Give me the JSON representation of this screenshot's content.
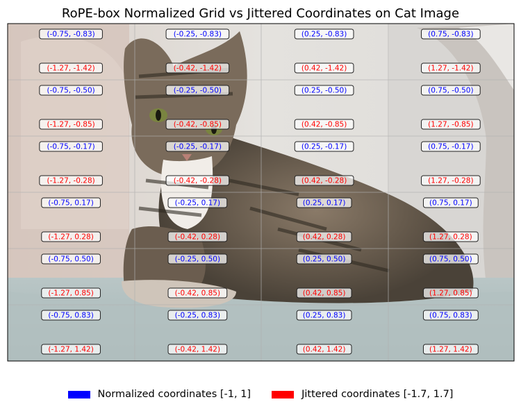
{
  "chart_data": {
    "type": "scatter",
    "title": "RoPE-box Normalized Grid vs Jittered Coordinates on Cat Image",
    "background_image": "cat-photo",
    "grid": true,
    "grid_columns": 4,
    "grid_rows": 6,
    "legend_placement": "bottom-center",
    "series": [
      {
        "name": "Normalized coordinates [-1, 1]",
        "color": "#0000ff",
        "labels": [
          [
            "(-0.75, -0.83)",
            "(-0.25, -0.83)",
            "(0.25, -0.83)",
            "(0.75, -0.83)"
          ],
          [
            "(-0.75, -0.50)",
            "(-0.25, -0.50)",
            "(0.25, -0.50)",
            "(0.75, -0.50)"
          ],
          [
            "(-0.75, -0.17)",
            "(-0.25, -0.17)",
            "(0.25, -0.17)",
            "(0.75, -0.17)"
          ],
          [
            "(-0.75, 0.17)",
            "(-0.25, 0.17)",
            "(0.25, 0.17)",
            "(0.75, 0.17)"
          ],
          [
            "(-0.75, 0.50)",
            "(-0.25, 0.50)",
            "(0.25, 0.50)",
            "(0.75, 0.50)"
          ],
          [
            "(-0.75, 0.83)",
            "(-0.25, 0.83)",
            "(0.25, 0.83)",
            "(0.75, 0.83)"
          ]
        ]
      },
      {
        "name": "Jittered coordinates [-1.7, 1.7]",
        "color": "#ff0000",
        "labels": [
          [
            "(-1.27, -1.42)",
            "(-0.42, -1.42)",
            "(0.42, -1.42)",
            "(1.27, -1.42)"
          ],
          [
            "(-1.27, -0.85)",
            "(-0.42, -0.85)",
            "(0.42, -0.85)",
            "(1.27, -0.85)"
          ],
          [
            "(-1.27, -0.28)",
            "(-0.42, -0.28)",
            "(0.42, -0.28)",
            "(1.27, -0.28)"
          ],
          [
            "(-1.27, 0.28)",
            "(-0.42, 0.28)",
            "(0.42, 0.28)",
            "(1.27, 0.28)"
          ],
          [
            "(-1.27, 0.85)",
            "(-0.42, 0.85)",
            "(0.42, 0.85)",
            "(1.27, 0.85)"
          ],
          [
            "(-1.27, 1.42)",
            "(-0.42, 1.42)",
            "(0.42, 1.42)",
            "(1.27, 1.42)"
          ]
        ]
      }
    ]
  }
}
